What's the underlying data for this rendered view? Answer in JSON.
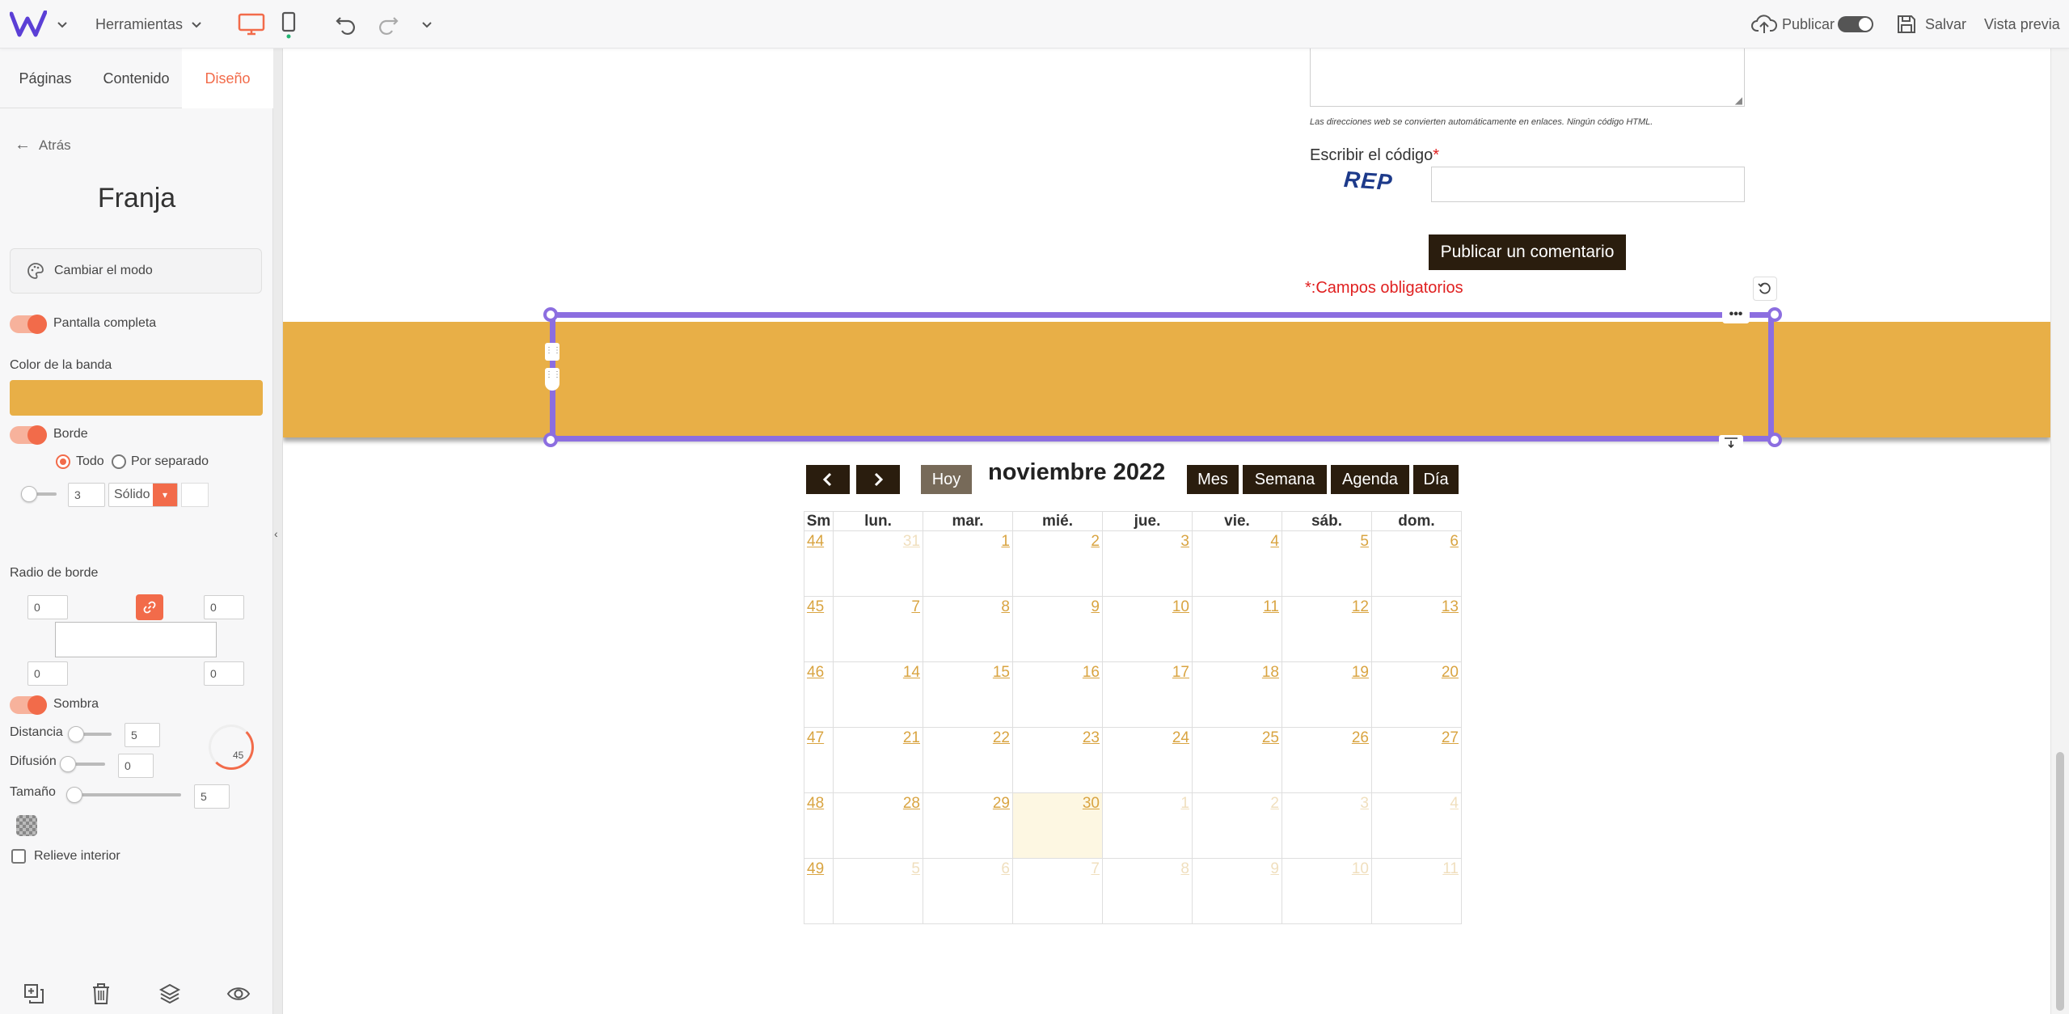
{
  "topbar": {
    "tools_label": "Herramientas",
    "publish_label": "Publicar",
    "save_label": "Salvar",
    "preview_label": "Vista previa"
  },
  "sidebar": {
    "tabs": [
      {
        "label": "Páginas",
        "active": false
      },
      {
        "label": "Contenido",
        "active": false
      },
      {
        "label": "Diseño",
        "active": true
      }
    ],
    "back_label": "Atrás",
    "panel_title": "Franja",
    "change_mode_label": "Cambiar el modo",
    "fullscreen_label": "Pantalla completa",
    "band_color_label": "Color de la banda",
    "band_color": "#e8af47",
    "border_label": "Borde",
    "border_all_label": "Todo",
    "border_separate_label": "Por separado",
    "border_width": "3",
    "border_style": "Sólido",
    "radius_label": "Radio de borde",
    "radius_tl": "0",
    "radius_tr": "0",
    "radius_bl": "0",
    "radius_br": "0",
    "shadow_label": "Sombra",
    "distance_label": "Distancia",
    "distance_value": "5",
    "diffusion_label": "Difusión",
    "diffusion_value": "0",
    "size_label": "Tamaño",
    "size_value": "5",
    "angle_value": "45",
    "inner_relief_label": "Relieve interior"
  },
  "form": {
    "url_note": "Las direcciones web se convierten automáticamente en enlaces. Ningún código HTML.",
    "code_label": "Escribir el código",
    "required_star": "*",
    "captcha_text": "REP",
    "submit_label": "Publicar un comentario",
    "required_fields_note": "*:Campos obligatorios"
  },
  "calendar": {
    "month_title": "noviembre 2022",
    "prev_label": "‹",
    "next_label": "›",
    "today_label": "Hoy",
    "views": [
      "Mes",
      "Semana",
      "Agenda",
      "Día"
    ],
    "headers": [
      "Sm",
      "lun.",
      "mar.",
      "mié.",
      "jue.",
      "vie.",
      "sáb.",
      "dom."
    ],
    "weeks": [
      {
        "week": "44",
        "days": [
          {
            "d": "31",
            "other": true
          },
          {
            "d": "1"
          },
          {
            "d": "2"
          },
          {
            "d": "3"
          },
          {
            "d": "4"
          },
          {
            "d": "5"
          },
          {
            "d": "6"
          }
        ]
      },
      {
        "week": "45",
        "days": [
          {
            "d": "7"
          },
          {
            "d": "8"
          },
          {
            "d": "9"
          },
          {
            "d": "10"
          },
          {
            "d": "11"
          },
          {
            "d": "12"
          },
          {
            "d": "13"
          }
        ]
      },
      {
        "week": "46",
        "days": [
          {
            "d": "14"
          },
          {
            "d": "15"
          },
          {
            "d": "16"
          },
          {
            "d": "17"
          },
          {
            "d": "18"
          },
          {
            "d": "19"
          },
          {
            "d": "20"
          }
        ]
      },
      {
        "week": "47",
        "days": [
          {
            "d": "21"
          },
          {
            "d": "22"
          },
          {
            "d": "23"
          },
          {
            "d": "24"
          },
          {
            "d": "25"
          },
          {
            "d": "26"
          },
          {
            "d": "27"
          }
        ]
      },
      {
        "week": "48",
        "days": [
          {
            "d": "28"
          },
          {
            "d": "29"
          },
          {
            "d": "30",
            "today": true
          },
          {
            "d": "1",
            "other": true
          },
          {
            "d": "2",
            "other": true
          },
          {
            "d": "3",
            "other": true
          },
          {
            "d": "4",
            "other": true
          }
        ]
      },
      {
        "week": "49",
        "days": [
          {
            "d": "5",
            "other": true
          },
          {
            "d": "6",
            "other": true
          },
          {
            "d": "7",
            "other": true
          },
          {
            "d": "8",
            "other": true
          },
          {
            "d": "9",
            "other": true
          },
          {
            "d": "10",
            "other": true
          },
          {
            "d": "11",
            "other": true
          }
        ]
      }
    ]
  },
  "colors": {
    "accent": "#f26b4a",
    "selection": "#8c6ee0",
    "band": "#e8af47",
    "calendar_link": "#d9a441",
    "dark_button": "#2a1d0e"
  }
}
